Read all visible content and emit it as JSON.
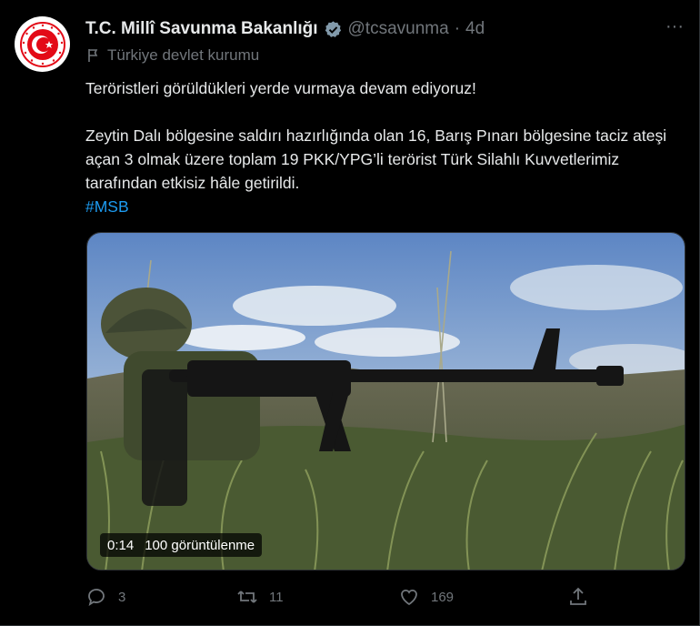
{
  "tweet": {
    "display_name": "T.C. Millî Savunma Bakanlığı",
    "handle": "@tcsavunma",
    "separator": "·",
    "time": "4d",
    "gov_label": "Türkiye devlet kurumu",
    "text_line1": "Teröristleri görüldükleri yerde vurmaya devam ediyoruz!",
    "text_line2": "Zeytin Dalı bölgesine saldırı hazırlığında olan 16, Barış Pınarı bölgesine taciz ateşi açan 3 olmak üzere toplam 19 PKK/YPG’li terörist Türk Silahlı Kuvvetlerimiz tarafından etkisiz hâle getirildi.",
    "hashtag": "#MSB",
    "more_label": "···"
  },
  "media": {
    "duration": "0:14",
    "views": "100 görüntülenme"
  },
  "actions": {
    "replies": "3",
    "retweets": "11",
    "likes": "169"
  },
  "colors": {
    "background": "#000000",
    "text": "#e7e9ea",
    "muted": "#71767b",
    "accent": "#1d9bf0",
    "brand_red": "#e30a17"
  },
  "icons": [
    "msb-logo-icon",
    "verified-badge-icon",
    "more-icon",
    "flag-icon",
    "reply-icon",
    "retweet-icon",
    "like-icon",
    "share-icon"
  ]
}
